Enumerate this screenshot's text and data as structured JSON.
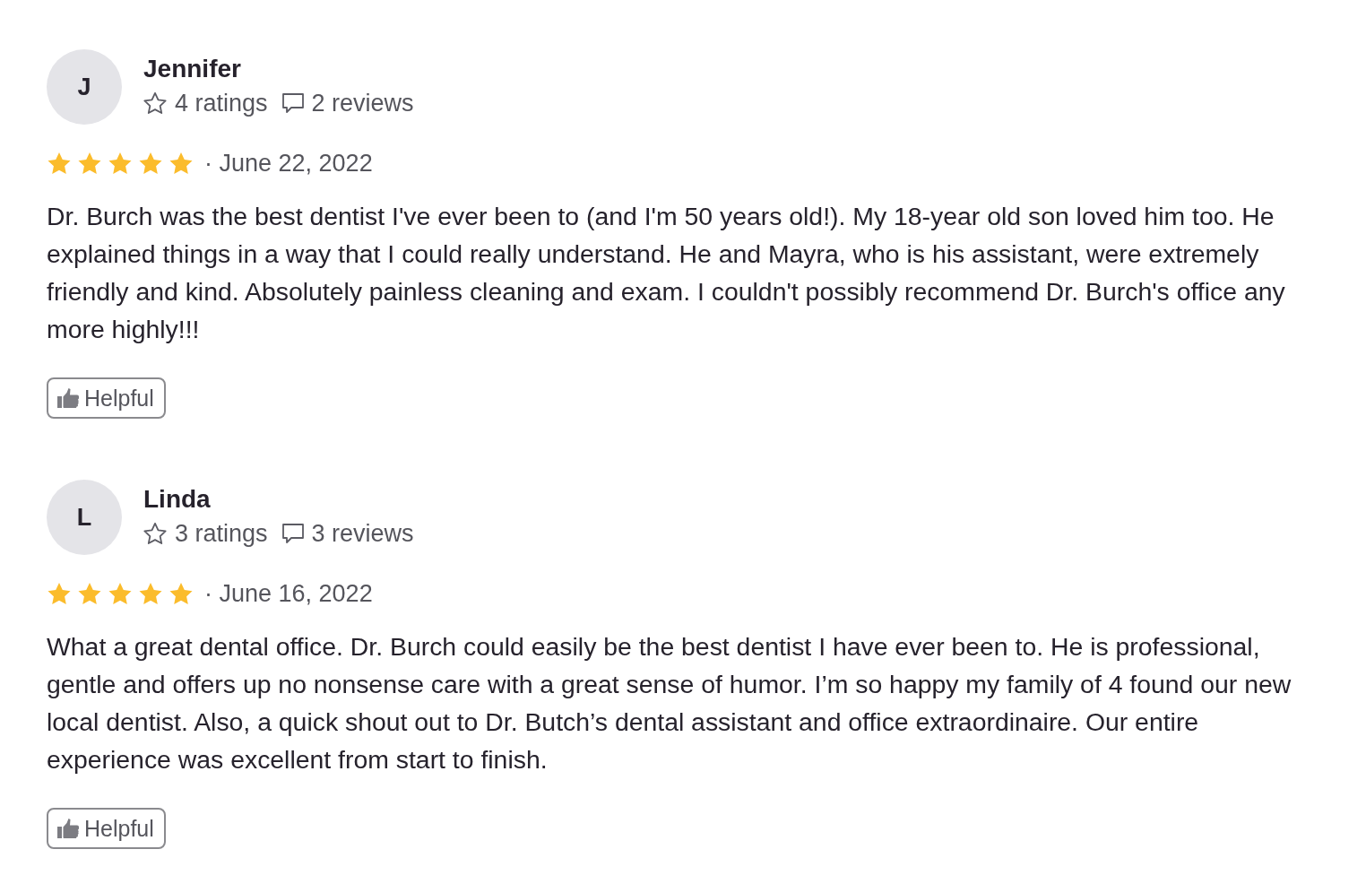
{
  "reviews": [
    {
      "initial": "J",
      "name": "Jennifer",
      "ratings": "4 ratings",
      "reviews": "2 reviews",
      "stars": 5,
      "date": "· June 22, 2022",
      "text": "Dr. Burch was the best dentist I've ever been to (and I'm 50 years old!). My 18-year old son loved him too. He explained things in a way that I could really understand. He and Mayra, who is his assistant, were extremely friendly and kind. Absolutely painless cleaning and exam. I couldn't possibly recommend Dr. Burch's office any more highly!!!",
      "helpful": "Helpful"
    },
    {
      "initial": "L",
      "name": "Linda",
      "ratings": "3 ratings",
      "reviews": "3 reviews",
      "stars": 5,
      "date": "· June 16, 2022",
      "text": "What a great dental office. Dr. Burch could easily be the best dentist I have ever been to. He is professional, gentle and offers up no nonsense care with a great sense of humor. I’m so happy my family of 4 found our new local dentist. Also, a quick shout out to Dr. Butch’s dental assistant and office extraordinaire. Our entire experience was excellent from start to finish.",
      "helpful": "Helpful"
    }
  ]
}
